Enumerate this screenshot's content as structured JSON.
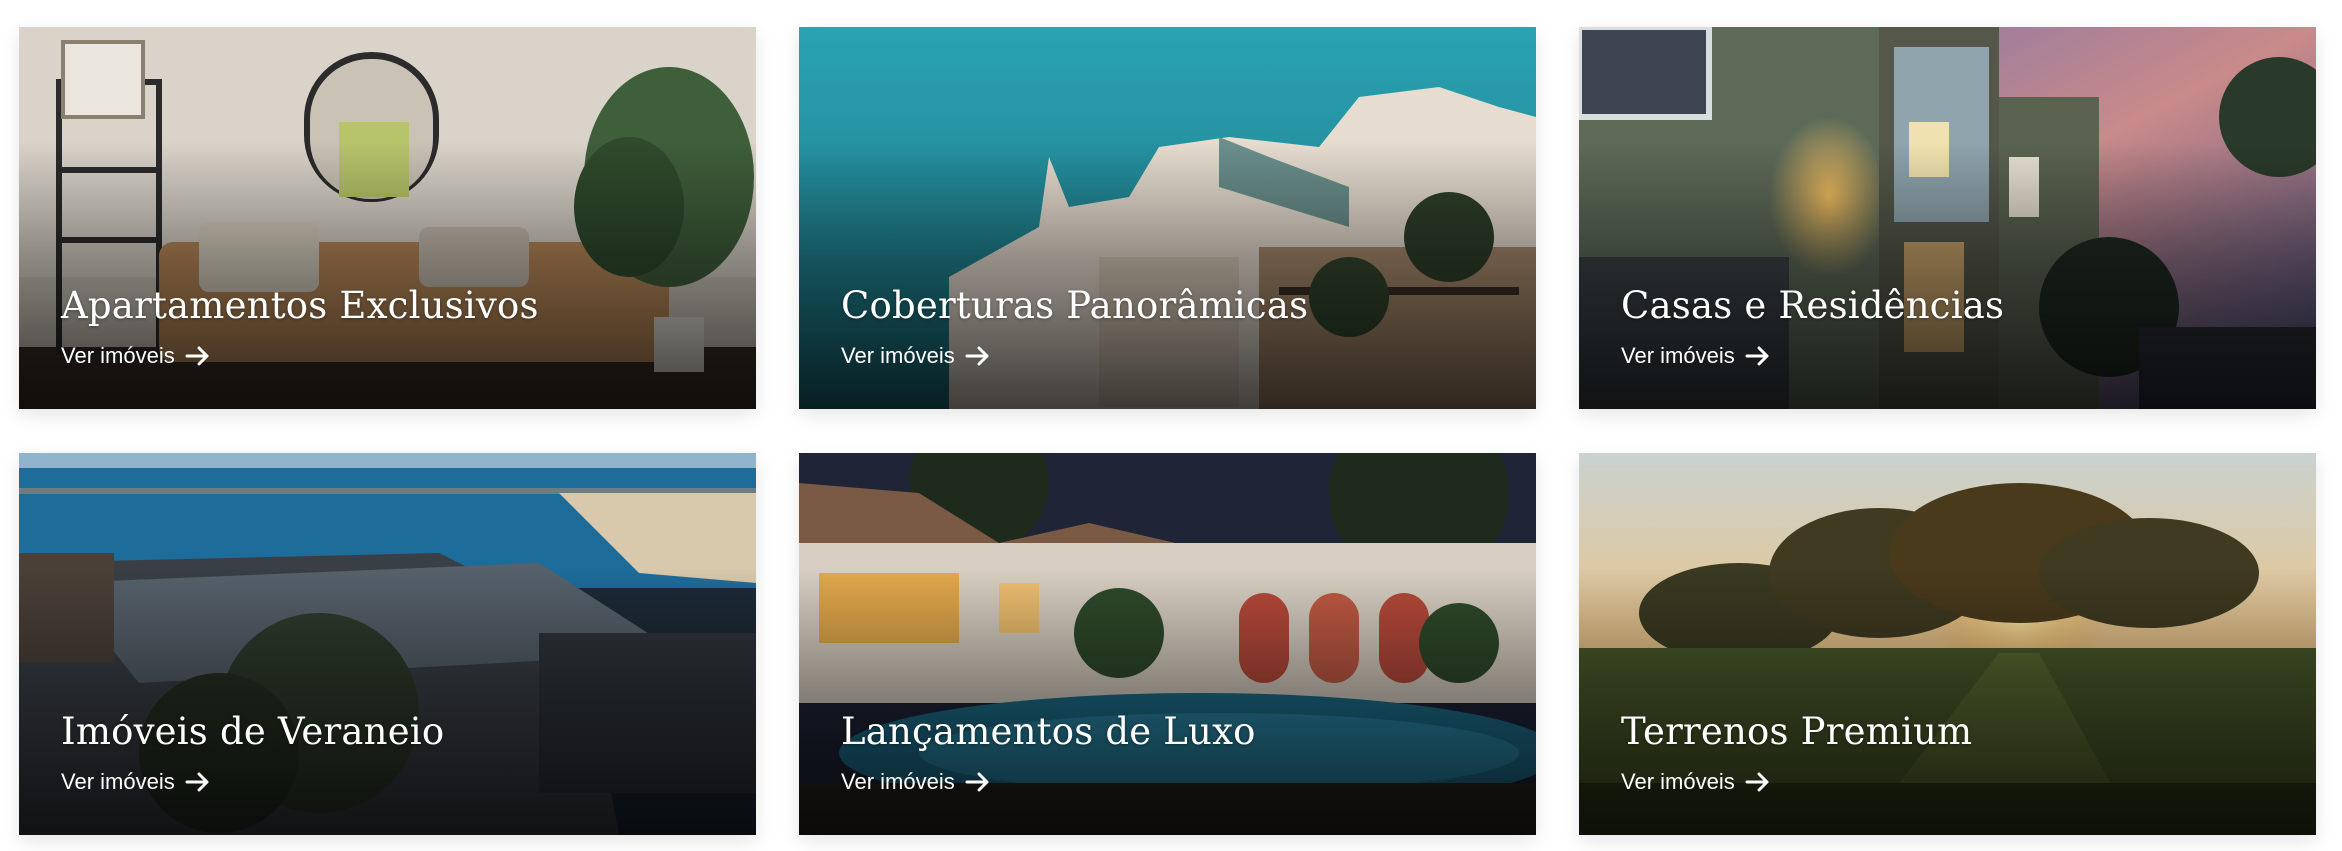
{
  "cards": [
    {
      "title": "Apartamentos Exclusivos",
      "cta": "Ver imóveis"
    },
    {
      "title": "Coberturas Panorâmicas",
      "cta": "Ver imóveis"
    },
    {
      "title": "Casas e Residências",
      "cta": "Ver imóveis"
    },
    {
      "title": "Imóveis de Veraneio",
      "cta": "Ver imóveis"
    },
    {
      "title": "Lançamentos de Luxo",
      "cta": "Ver imóveis"
    },
    {
      "title": "Terrenos Premium",
      "cta": "Ver imóveis"
    }
  ],
  "icons": {
    "cta": "arrow-right-icon"
  }
}
